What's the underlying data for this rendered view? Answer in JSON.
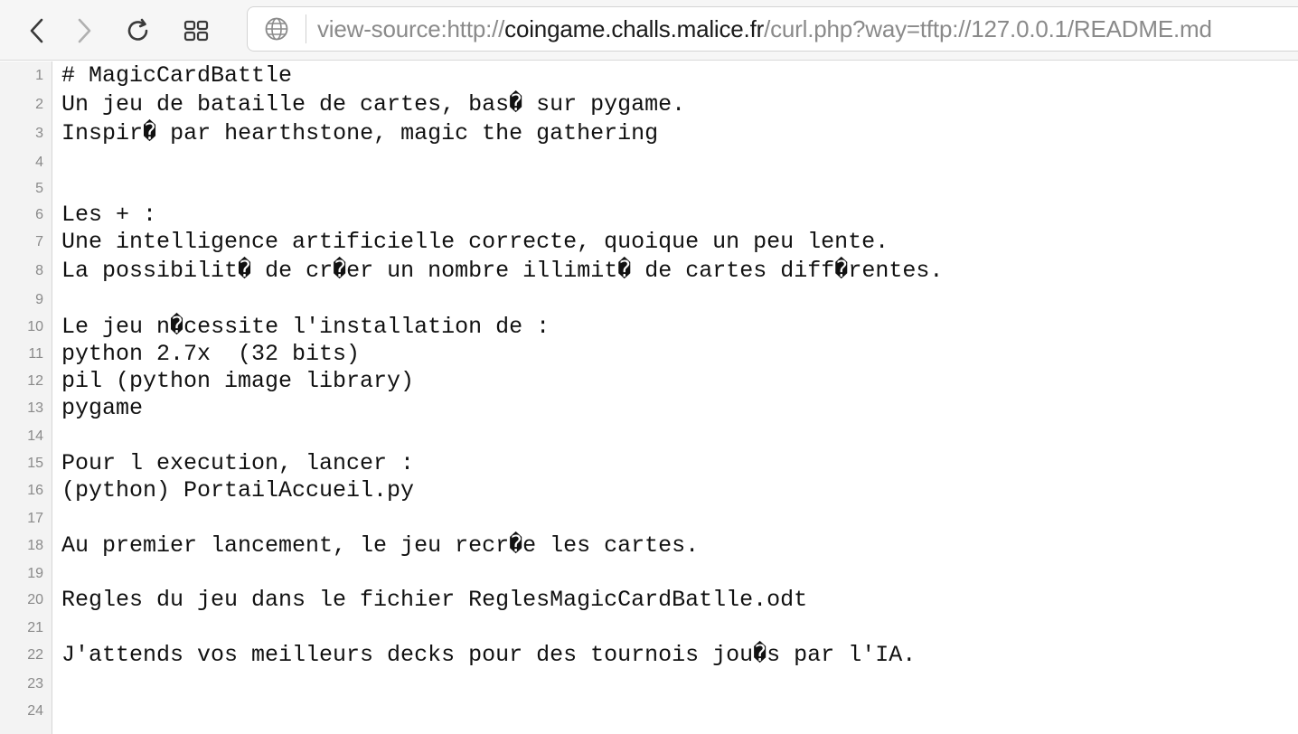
{
  "toolbar": {
    "back_icon": "chevron-left-icon",
    "forward_icon": "chevron-right-icon",
    "reload_icon": "reload-icon",
    "tabs_icon": "grid-icon",
    "site_icon": "globe-icon"
  },
  "address": {
    "prefix": "view-source:http://",
    "host": "coingame.challs.malice.fr",
    "path": "/curl.php?way=tftp://127.0.0.1/README.md"
  },
  "source": {
    "lines": [
      {
        "n": "1",
        "text": "# MagicCardBattle"
      },
      {
        "n": "2",
        "text": "Un jeu de bataille de cartes, bas� sur pygame."
      },
      {
        "n": "3",
        "text": "Inspir� par hearthstone, magic the gathering"
      },
      {
        "n": "4",
        "text": ""
      },
      {
        "n": "5",
        "text": ""
      },
      {
        "n": "6",
        "text": "Les + :"
      },
      {
        "n": "7",
        "text": "Une intelligence artificielle correcte, quoique un peu lente."
      },
      {
        "n": "8",
        "text": "La possibilit� de cr�er un nombre illimit� de cartes diff�rentes."
      },
      {
        "n": "9",
        "text": ""
      },
      {
        "n": "10",
        "text": "Le jeu n�cessite l'installation de :"
      },
      {
        "n": "11",
        "text": "python 2.7x  (32 bits)"
      },
      {
        "n": "12",
        "text": "pil (python image library)"
      },
      {
        "n": "13",
        "text": "pygame"
      },
      {
        "n": "14",
        "text": ""
      },
      {
        "n": "15",
        "text": "Pour l execution, lancer :"
      },
      {
        "n": "16",
        "text": "(python) PortailAccueil.py"
      },
      {
        "n": "17",
        "text": ""
      },
      {
        "n": "18",
        "text": "Au premier lancement, le jeu recr�e les cartes."
      },
      {
        "n": "19",
        "text": ""
      },
      {
        "n": "20",
        "text": "Regles du jeu dans le fichier ReglesMagicCardBatlle.odt"
      },
      {
        "n": "21",
        "text": ""
      },
      {
        "n": "22",
        "text": "J'attends vos meilleurs decks pour des tournois jou�s par l'IA."
      },
      {
        "n": "23",
        "text": ""
      },
      {
        "n": "24",
        "text": ""
      }
    ]
  }
}
